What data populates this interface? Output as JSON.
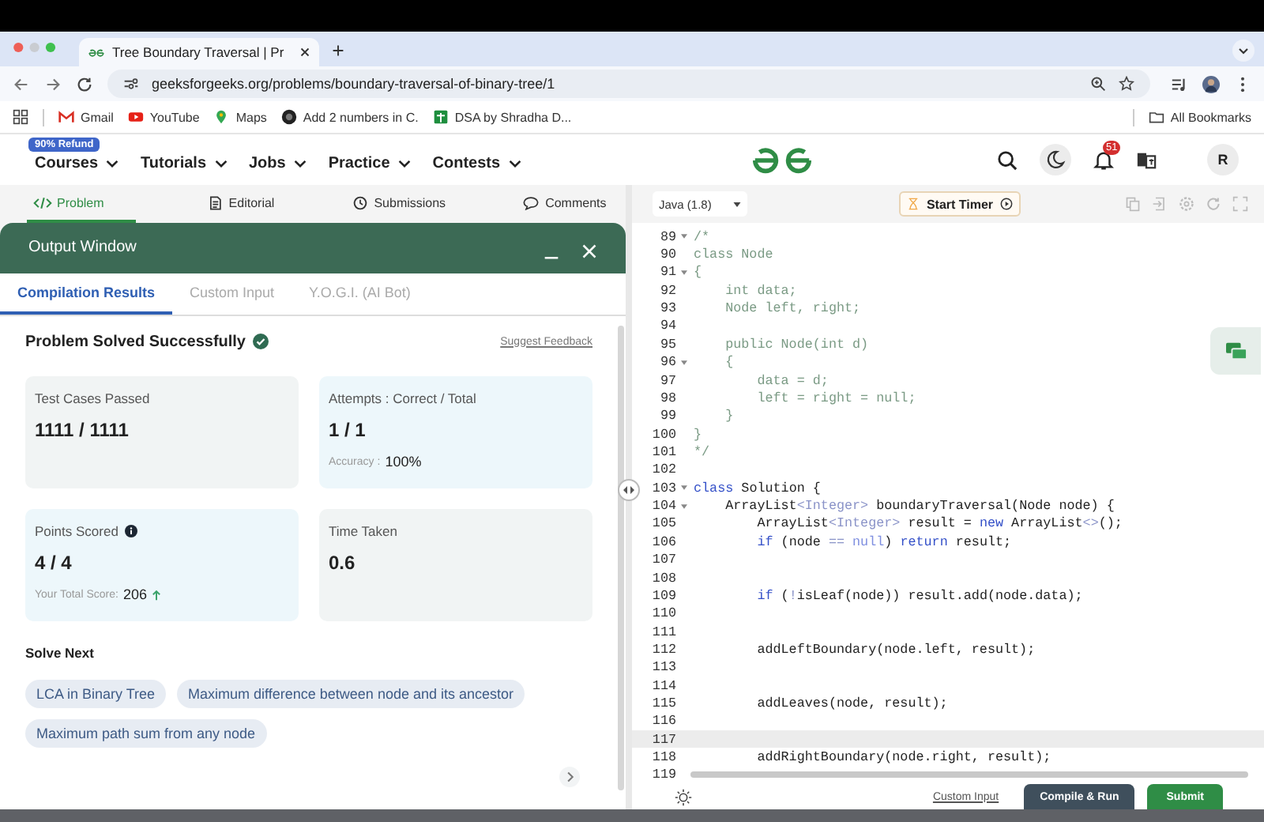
{
  "browser": {
    "tab_title": "Tree Boundary Traversal | Pr",
    "url": "geeksforgeeks.org/problems/boundary-traversal-of-binary-tree/1",
    "all_bookmarks": "All Bookmarks",
    "bookmarks": [
      {
        "label": "Gmail",
        "kind": "gmail"
      },
      {
        "label": "YouTube",
        "kind": "youtube"
      },
      {
        "label": "Maps",
        "kind": "maps"
      },
      {
        "label": "Add 2 numbers in C.",
        "kind": "github"
      },
      {
        "label": "DSA by Shradha D...",
        "kind": "sheets"
      }
    ]
  },
  "site_nav": {
    "badge": "90% Refund",
    "menus": [
      "Courses",
      "Tutorials",
      "Jobs",
      "Practice",
      "Contests"
    ],
    "notifications": "51",
    "avatar": "R"
  },
  "problem_tabs": [
    {
      "label": "Problem",
      "selected": true,
      "kind": "code"
    },
    {
      "label": "Editorial",
      "selected": false,
      "kind": "doc"
    },
    {
      "label": "Submissions",
      "selected": false,
      "kind": "clock"
    },
    {
      "label": "Comments",
      "selected": false,
      "kind": "chat"
    }
  ],
  "output_window": {
    "title": "Output Window",
    "tabs": [
      {
        "label": "Compilation Results",
        "selected": true
      },
      {
        "label": "Custom Input",
        "selected": false
      },
      {
        "label": "Y.O.G.I. (AI Bot)",
        "selected": false
      }
    ],
    "status": "Problem Solved Successfully",
    "feedback": "Suggest Feedback",
    "cards": [
      {
        "title": "Test Cases Passed",
        "value": "1111 / 1111",
        "color": "#f1f4f4"
      },
      {
        "title": "Attempts : Correct / Total",
        "value": "1 / 1",
        "note_label": "Accuracy :",
        "note_value": "100%",
        "color": "#edf7fb"
      },
      {
        "title": "Points Scored",
        "info": true,
        "value": "4 / 4",
        "note_label": "Your Total Score:",
        "note_value": "206",
        "trend_up": true,
        "color": "#edf7fb"
      },
      {
        "title": "Time Taken",
        "value": "0.6",
        "color": "#f1f4f4"
      }
    ],
    "solve_next_title": "Solve Next",
    "suggestions": [
      "LCA in Binary Tree",
      "Maximum difference between node and its ancestor",
      "Maximum path sum from any node"
    ]
  },
  "editor": {
    "language": "Java (1.8)",
    "timer": "Start Timer",
    "custom_input": "Custom Input",
    "compile": "Compile & Run",
    "submit": "Submit",
    "lines": [
      {
        "number": "89",
        "fold": true,
        "selected": false,
        "parts": [
          {
            "text": "/*",
            "kind": "comment"
          }
        ]
      },
      {
        "number": "90",
        "fold": false,
        "selected": false,
        "parts": [
          {
            "text": "class Node",
            "kind": "comment"
          }
        ]
      },
      {
        "number": "91",
        "fold": true,
        "selected": false,
        "parts": [
          {
            "text": "{",
            "kind": "comment"
          }
        ]
      },
      {
        "number": "92",
        "fold": false,
        "selected": false,
        "parts": [
          {
            "text": "    int data;",
            "kind": "comment"
          }
        ]
      },
      {
        "number": "93",
        "fold": false,
        "selected": false,
        "parts": [
          {
            "text": "    Node left, right;",
            "kind": "comment"
          }
        ]
      },
      {
        "number": "94",
        "fold": false,
        "selected": false
      },
      {
        "number": "95",
        "fold": false,
        "selected": false,
        "parts": [
          {
            "text": "    public Node(int d)",
            "kind": "comment"
          }
        ]
      },
      {
        "number": "96",
        "fold": true,
        "selected": false,
        "parts": [
          {
            "text": "    {",
            "kind": "comment"
          }
        ]
      },
      {
        "number": "97",
        "fold": false,
        "selected": false,
        "parts": [
          {
            "text": "        data = d;",
            "kind": "comment"
          }
        ]
      },
      {
        "number": "98",
        "fold": false,
        "selected": false,
        "parts": [
          {
            "text": "        left = right = null;",
            "kind": "comment"
          }
        ]
      },
      {
        "number": "99",
        "fold": false,
        "selected": false,
        "parts": [
          {
            "text": "    }",
            "kind": "comment"
          }
        ]
      },
      {
        "number": "100",
        "fold": false,
        "selected": false,
        "parts": [
          {
            "text": "}",
            "kind": "comment"
          }
        ]
      },
      {
        "number": "101",
        "fold": false,
        "selected": false,
        "parts": [
          {
            "text": "*/",
            "kind": "comment"
          }
        ]
      },
      {
        "number": "102",
        "fold": false,
        "selected": false
      },
      {
        "number": "103",
        "fold": true,
        "selected": false,
        "parts": [
          {
            "text": "class",
            "kind": "keyword"
          },
          {
            "text": " Solution {",
            "kind": "plain"
          }
        ]
      },
      {
        "number": "104",
        "fold": true,
        "selected": false,
        "parts": [
          {
            "text": "    ArrayList",
            "kind": "plain"
          },
          {
            "text": "<Integer>",
            "kind": "type"
          },
          {
            "text": " boundaryTraversal(Node node) {",
            "kind": "plain"
          }
        ]
      },
      {
        "number": "105",
        "fold": false,
        "selected": false,
        "parts": [
          {
            "text": "        ArrayList",
            "kind": "plain"
          },
          {
            "text": "<Integer>",
            "kind": "type"
          },
          {
            "text": " result = ",
            "kind": "plain"
          },
          {
            "text": "new",
            "kind": "keyword"
          },
          {
            "text": " ArrayList",
            "kind": "plain"
          },
          {
            "text": "<>",
            "kind": "type"
          },
          {
            "text": "();",
            "kind": "plain"
          }
        ]
      },
      {
        "number": "106",
        "fold": false,
        "selected": false,
        "parts": [
          {
            "text": "        if",
            "kind": "keyword"
          },
          {
            "text": " (node ",
            "kind": "plain"
          },
          {
            "text": "== ",
            "kind": "type"
          },
          {
            "text": "null",
            "kind": "constant"
          },
          {
            "text": ") ",
            "kind": "plain"
          },
          {
            "text": "return",
            "kind": "keyword"
          },
          {
            "text": " result;",
            "kind": "plain"
          }
        ]
      },
      {
        "number": "107",
        "fold": false,
        "selected": false
      },
      {
        "number": "108",
        "fold": false,
        "selected": false
      },
      {
        "number": "109",
        "fold": false,
        "selected": false,
        "parts": [
          {
            "text": "        if",
            "kind": "keyword"
          },
          {
            "text": " (",
            "kind": "plain"
          },
          {
            "text": "!",
            "kind": "type"
          },
          {
            "text": "isLeaf(node)) result.add(node.data);",
            "kind": "plain"
          }
        ]
      },
      {
        "number": "110",
        "fold": false,
        "selected": false
      },
      {
        "number": "111",
        "fold": false,
        "selected": false
      },
      {
        "number": "112",
        "fold": false,
        "selected": false,
        "parts": [
          {
            "text": "        addLeftBoundary(node.left, result);",
            "kind": "plain"
          }
        ]
      },
      {
        "number": "113",
        "fold": false,
        "selected": false
      },
      {
        "number": "114",
        "fold": false,
        "selected": false
      },
      {
        "number": "115",
        "fold": false,
        "selected": false,
        "parts": [
          {
            "text": "        addLeaves(node, result);",
            "kind": "plain"
          }
        ]
      },
      {
        "number": "116",
        "fold": false,
        "selected": false
      },
      {
        "number": "117",
        "fold": false,
        "selected": true
      },
      {
        "number": "118",
        "fold": false,
        "selected": false,
        "parts": [
          {
            "text": "        addRightBoundary(node.right, result);",
            "kind": "plain"
          }
        ]
      },
      {
        "number": "119",
        "fold": false,
        "selected": false
      }
    ]
  }
}
